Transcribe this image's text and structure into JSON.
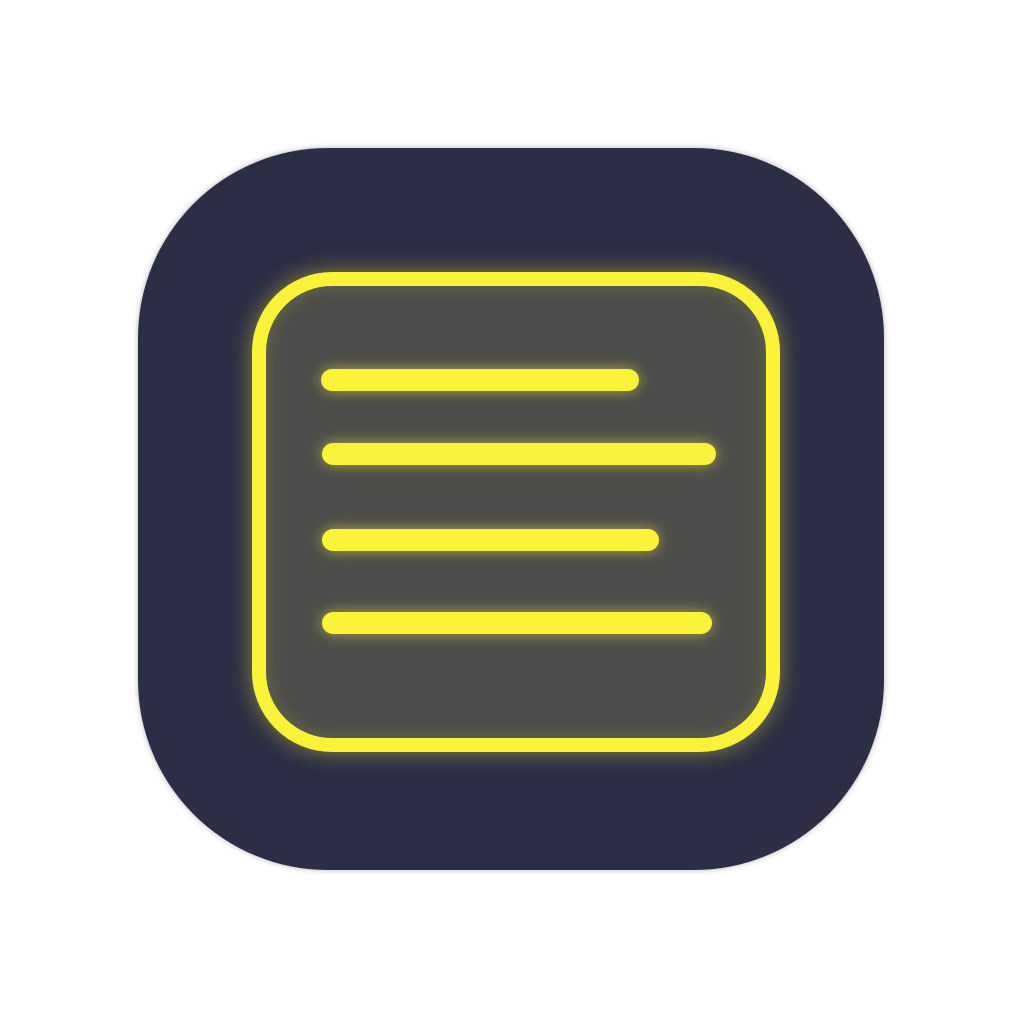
{
  "icon": {
    "name": "document-lines-app-icon",
    "glyph": "text-lines-icon",
    "colors": {
      "background": "#ffffff",
      "tile": "#2c2e45",
      "panel": "#4d4d4b",
      "accent": "#fbf23a"
    },
    "line_count": 4
  }
}
